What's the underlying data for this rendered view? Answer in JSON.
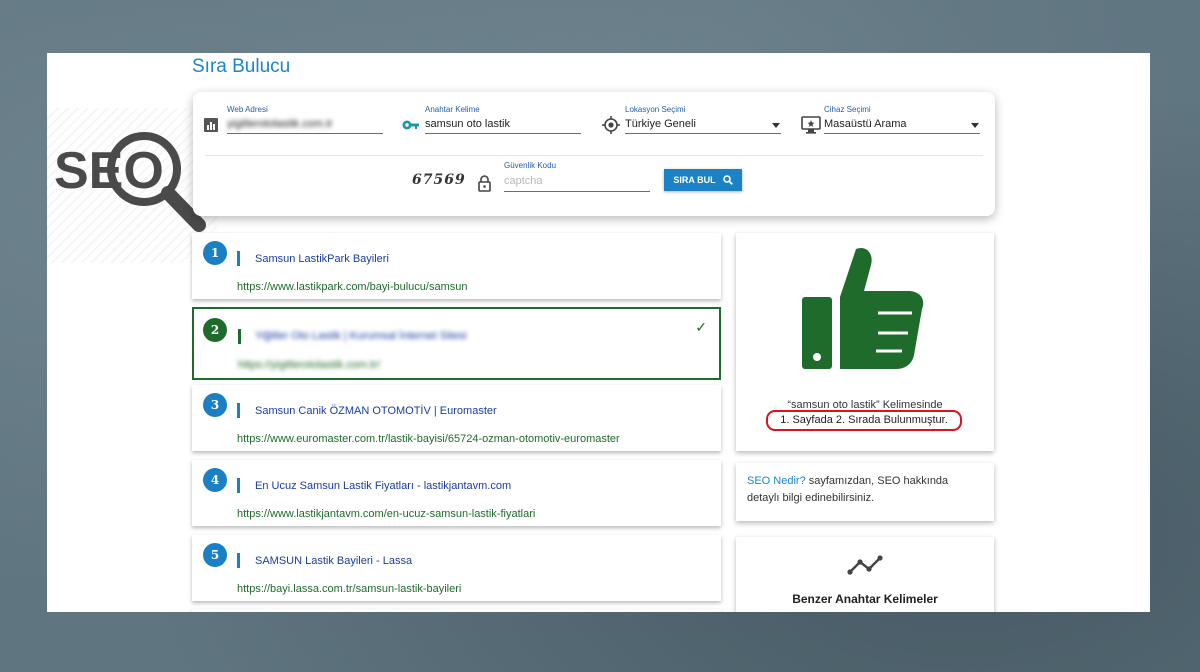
{
  "page": {
    "title": "Sıra Bulucu",
    "logo_text": "SEO"
  },
  "search": {
    "web_address": {
      "label": "Web Adresi",
      "value": "yigitlerotolastik.com.tr",
      "icon": "bar-chart-icon"
    },
    "keyword": {
      "label": "Anahtar Kelime",
      "value": "samsun oto lastik",
      "icon": "key-icon"
    },
    "location": {
      "label": "Lokasyon Seçimi",
      "value": "Türkiye Geneli",
      "icon": "location-crosshair-icon"
    },
    "device": {
      "label": "Cihaz Seçimi",
      "value": "Masaüstü Arama",
      "icon": "desktop-icon"
    },
    "captcha": {
      "label": "Güvenlik Kodu",
      "image_text": "67569",
      "placeholder": "captcha",
      "icon": "lock-icon"
    },
    "submit_label": "SIRA BUL"
  },
  "results": [
    {
      "rank": "1",
      "title": "Samsun LastikPark Bayileri",
      "url": "https://www.lastikpark.com/bayi-bulucu/samsun",
      "highlight": false
    },
    {
      "rank": "2",
      "title": "Yiğitler Oto Lastik | Kurumsal İnternet Sitesi",
      "url": "https://yigitlerotolastik.com.tr/",
      "highlight": true
    },
    {
      "rank": "3",
      "title": "Samsun Canik ÖZMAN OTOMOTİV | Euromaster",
      "url": "https://www.euromaster.com.tr/lastik-bayisi/65724-ozman-otomotiv-euromaster",
      "highlight": false
    },
    {
      "rank": "4",
      "title": "En Ucuz Samsun Lastik Fiyatları - lastikjantavm.com",
      "url": "https://www.lastikjantavm.com/en-ucuz-samsun-lastik-fiyatlari",
      "highlight": false
    },
    {
      "rank": "5",
      "title": "SAMSUN Lastik Bayileri - Lassa",
      "url": "https://bayi.lassa.com.tr/samsun-lastik-bayileri",
      "highlight": false
    }
  ],
  "rank_panel": {
    "keyword_line": "“samsun oto lastik” Kelimesinde",
    "result_line": "1. Sayfada 2. Sırada Bulunmuştur.",
    "icon": "thumbs-up-icon"
  },
  "seo_info": {
    "link_text": "SEO Nedir?",
    "text": " sayfamızdan, SEO hakkında detaylı bilgi edinebilirsiniz."
  },
  "similar": {
    "title": "Benzer Anahtar Kelimeler",
    "icon": "trend-line-icon"
  },
  "colors": {
    "accent_blue": "#1b82c5",
    "result_green": "#1e6b2b",
    "title_blue": "#1a3d9e",
    "highlight_red": "#d9141b"
  }
}
